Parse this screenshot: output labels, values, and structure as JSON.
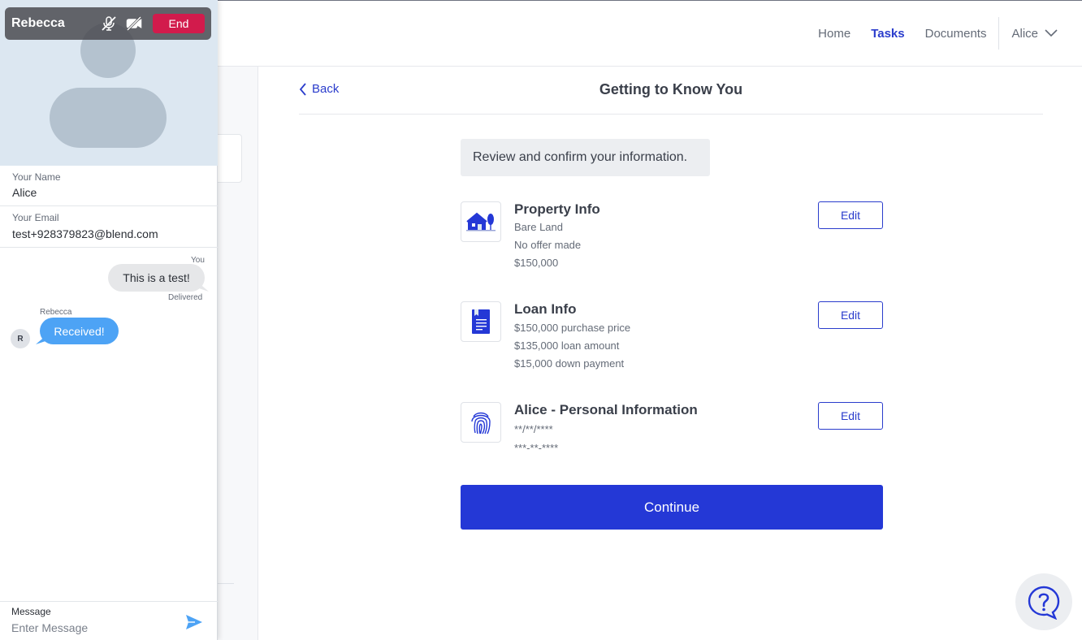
{
  "nav": {
    "links": [
      "Home",
      "Tasks",
      "Documents"
    ],
    "active": "Tasks",
    "user": "Alice"
  },
  "page": {
    "back_label": "Back",
    "title": "Getting to Know You",
    "banner": "Review and confirm your information.",
    "sections": [
      {
        "icon": "house-icon",
        "title": "Property Info",
        "lines": [
          "Bare Land",
          "No offer made",
          "$150,000"
        ],
        "edit_label": "Edit"
      },
      {
        "icon": "document-icon",
        "title": "Loan Info",
        "lines": [
          "$150,000 purchase price",
          "$135,000 loan amount",
          "$15,000 down payment"
        ],
        "edit_label": "Edit"
      },
      {
        "icon": "fingerprint-icon",
        "title": "Alice - Personal Information",
        "lines": [
          "**/**/****",
          "***-**-****"
        ],
        "edit_label": "Edit"
      }
    ],
    "continue_label": "Continue"
  },
  "chat": {
    "caller_name": "Rebecca",
    "end_label": "End",
    "name_label": "Your Name",
    "name_value": "Alice",
    "email_label": "Your Email",
    "email_value": "test+928379823@blend.com",
    "messages": {
      "out_sender": "You",
      "out_text": "This is a test!",
      "out_status": "Delivered",
      "in_sender": "Rebecca",
      "in_text": "Received!",
      "in_avatar_initial": "R"
    },
    "compose_label": "Message",
    "compose_placeholder": "Enter Message"
  },
  "colors": {
    "accent": "#2438d6",
    "end_button": "#d21b4c",
    "incoming_bubble": "#4da3f5"
  }
}
